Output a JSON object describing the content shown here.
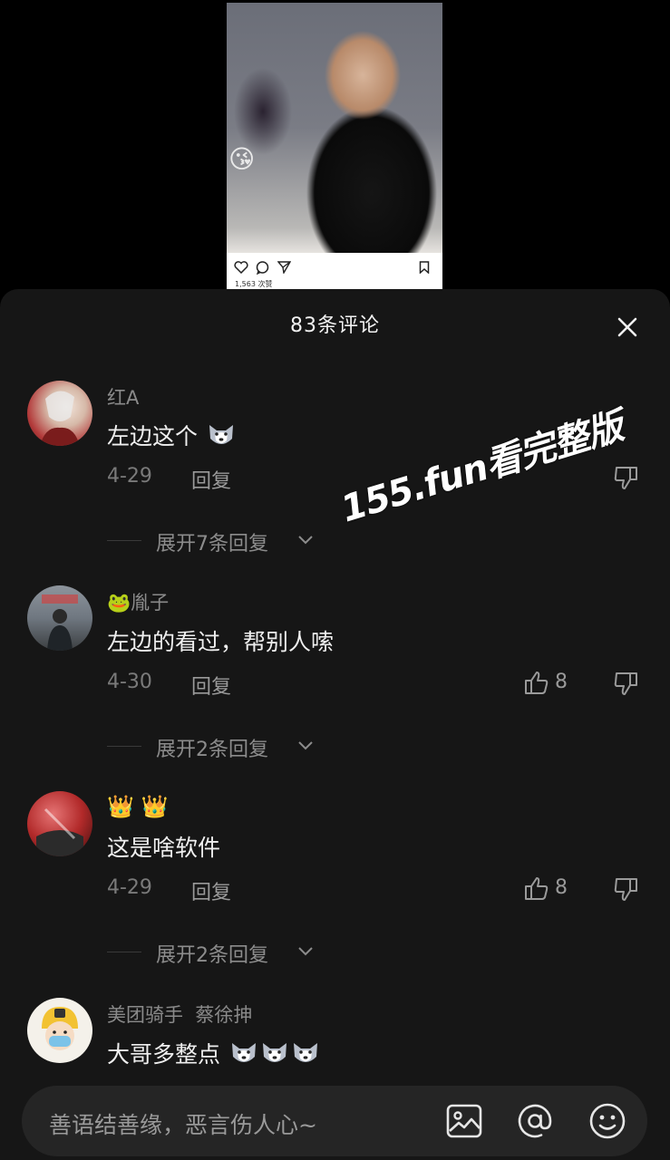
{
  "preview": {
    "likes_text": "1,563 次赞",
    "emoji": "😘"
  },
  "sheet": {
    "title": "83条评论",
    "comments": [
      {
        "username": "红A",
        "text": "左边这个",
        "emoji_count": 1,
        "date": "4-29",
        "reply_label": "回复",
        "likes": "",
        "expand_label": "展开7条回复"
      },
      {
        "username_emoji": "🐸",
        "username": "胤子",
        "text": "左边的看过，帮别人嗦",
        "date": "4-30",
        "reply_label": "回复",
        "likes": "8",
        "expand_label": "展开2条回复"
      },
      {
        "username": "👑 👑",
        "text": "这是啥软件",
        "date": "4-29",
        "reply_label": "回复",
        "likes": "8",
        "expand_label": "展开2条回复"
      },
      {
        "username": "美团骑手  蔡徐抻",
        "text": "大哥多整点",
        "emoji_count": 3
      }
    ]
  },
  "watermark": "155.fun看完整版",
  "input": {
    "placeholder": "善语结善缘，恶言伤人心~"
  },
  "colors": {
    "sheet_bg": "#161616",
    "input_bg": "#252525",
    "muted_text": "#8a8a8a"
  }
}
